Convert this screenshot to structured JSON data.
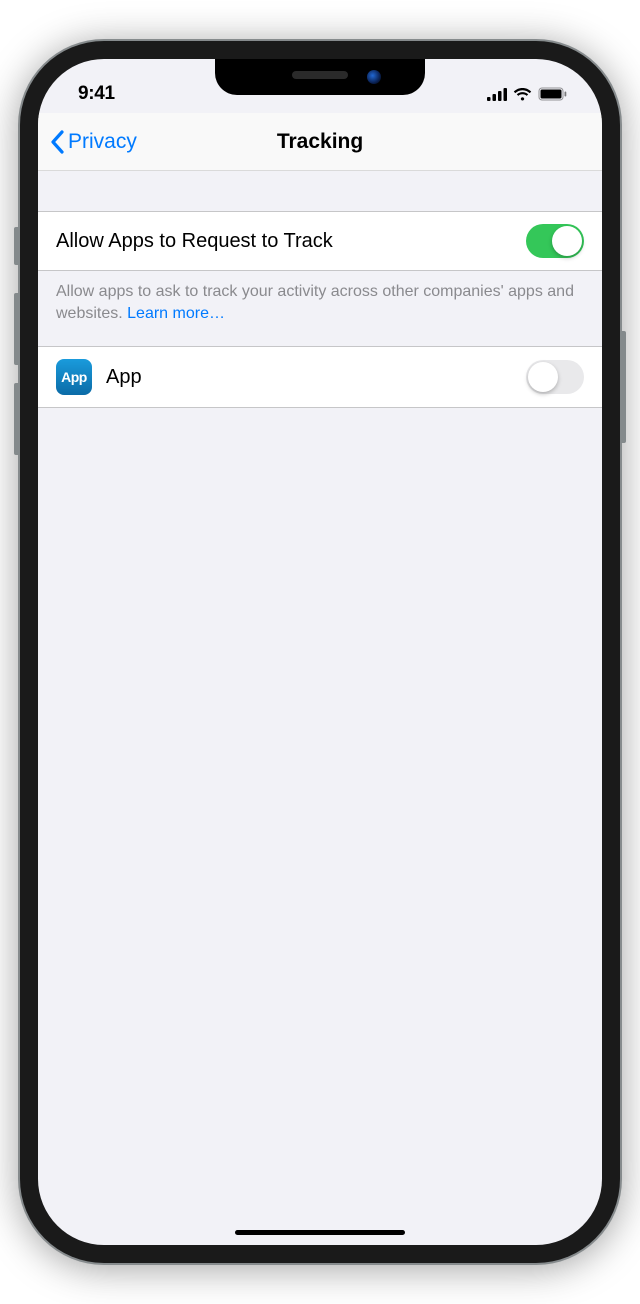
{
  "status": {
    "time": "9:41"
  },
  "nav": {
    "back_label": "Privacy",
    "title": "Tracking"
  },
  "settings": {
    "allow_request": {
      "label": "Allow Apps to Request to Track",
      "enabled": true
    },
    "footer_text": "Allow apps to ask to track your activity across other companies' apps and websites. ",
    "learn_more": "Learn more…"
  },
  "apps": [
    {
      "name": "App",
      "icon_text": "App",
      "enabled": false
    }
  ]
}
